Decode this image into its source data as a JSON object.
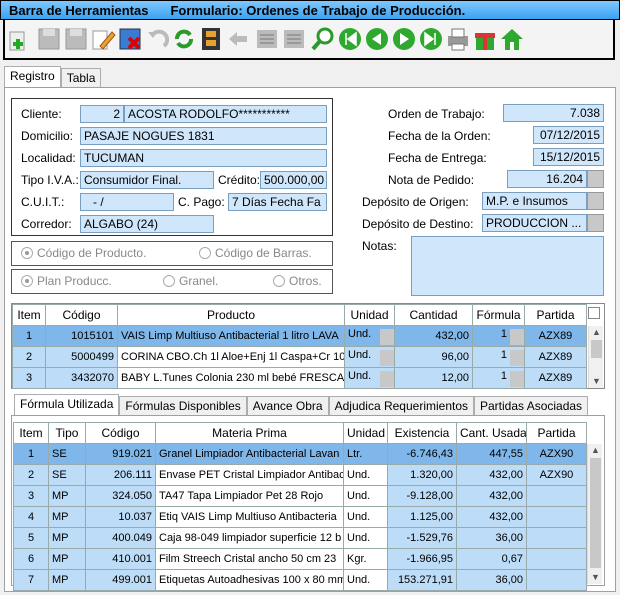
{
  "title_left": "Barra de Herramientas",
  "title_right": "Formulario: Ordenes de Trabajo de Producción.",
  "toolbar": [
    "add-icon",
    "save-icon",
    "save-as-icon",
    "edit-icon",
    "delete-icon",
    "undo-icon",
    "refresh-icon",
    "film-icon",
    "back-icon",
    "list-icon",
    "list-icon",
    "search-icon",
    "first-icon",
    "prev-icon",
    "next-icon",
    "last-icon",
    "print-icon",
    "gift-icon",
    "home-icon"
  ],
  "top_tabs": [
    "Registro",
    "Tabla"
  ],
  "form": {
    "cliente_label": "Cliente:",
    "cliente_num": "2",
    "cliente_name": "ACOSTA RODOLFO***********",
    "domicilio_label": "Domicilio:",
    "domicilio": "PASAJE NOGUES 1831",
    "localidad_label": "Localidad:",
    "localidad": "TUCUMAN",
    "iva_label": "Tipo I.V.A.:",
    "iva": "Consumidor Final.",
    "credito_label": "Crédito:",
    "credito": "500.000,00",
    "cuit_label": "C.U.I.T.:",
    "cuit": "-        /",
    "cpago_label": "C. Pago:",
    "cpago": "7 Días Fecha Fa",
    "corredor_label": "Corredor:",
    "corredor": "ALGABO (24)",
    "orden_label": "Orden de Trabajo:",
    "orden": "7.038",
    "fecha_orden_label": "Fecha de la Orden:",
    "fecha_orden": "07/12/2015",
    "fecha_entrega_label": "Fecha de Entrega:",
    "fecha_entrega": "15/12/2015",
    "nota_label": "Nota de Pedido:",
    "nota": "16.204",
    "dep_origen_label": "Depósito de Origen:",
    "dep_origen": "M.P. e Insumos",
    "dep_destino_label": "Depósito de Destino:",
    "dep_destino": "PRODUCCION ...",
    "notas_label": "Notas:"
  },
  "radios1": [
    "Código de Producto.",
    "Código de Barras."
  ],
  "radios2": [
    "Plan Producc.",
    "Granel.",
    "Otros."
  ],
  "products": {
    "headers": [
      "Item",
      "Código",
      "Producto",
      "Unidad",
      "Cantidad",
      "Fórmula",
      "Partida"
    ],
    "rows": [
      [
        "1",
        "1015101",
        "VAIS Limp Multiuso Antibacterial 1 litro LAVA",
        "Und.",
        "432,00",
        "1",
        "AZX89"
      ],
      [
        "2",
        "5000499",
        "CORINA CBO.Ch 1l  Aloe+Enj 1l Caspa+Cr 10(",
        "Und.",
        "96,00",
        "1",
        "AZX89"
      ],
      [
        "3",
        "3432070",
        "BABY L.Tunes Colonia 230 ml bebé FRESCA",
        "Und.",
        "12,00",
        "1",
        "AZX89"
      ]
    ]
  },
  "sub_tabs": [
    "Fórmula Utilizada",
    "Fórmulas Disponibles",
    "Avance Obra",
    "Adjudica Requerimientos",
    "Partidas Asociadas"
  ],
  "formula": {
    "headers": [
      "Item",
      "Tipo",
      "Código",
      "Materia Prima",
      "Unidad",
      "Existencia",
      "Cant. Usada",
      "Partida"
    ],
    "rows": [
      [
        "1",
        "SE",
        "919.021",
        "Granel Limpiador Antibacterial Lavan",
        "Ltr.",
        "-6.746,43",
        "447,55",
        "AZX90"
      ],
      [
        "2",
        "SE",
        "206.111",
        "Envase PET Cristal Limpiador Antibac",
        "Und.",
        "1.320,00",
        "432,00",
        "AZX90"
      ],
      [
        "3",
        "MP",
        "324.050",
        "TA47 Tapa Limpiador Pet 28 Rojo",
        "Und.",
        "-9.128,00",
        "432,00",
        ""
      ],
      [
        "4",
        "MP",
        "10.037",
        "Etiq VAIS Limp Multiuso Antibacteria",
        "Und.",
        "1.125,00",
        "432,00",
        ""
      ],
      [
        "5",
        "MP",
        "400.049",
        "Caja 98-049 limpiador superficie 12 b",
        "Und.",
        "-1.529,76",
        "36,00",
        ""
      ],
      [
        "6",
        "MP",
        "410.001",
        "Film Streech Cristal ancho 50 cm 23",
        "Kgr.",
        "-1.966,95",
        "0,67",
        ""
      ],
      [
        "7",
        "MP",
        "499.001",
        "Etiquetas Autoadhesivas 100 x 80 mm",
        "Und.",
        "153.271,91",
        "36,00",
        ""
      ]
    ]
  }
}
